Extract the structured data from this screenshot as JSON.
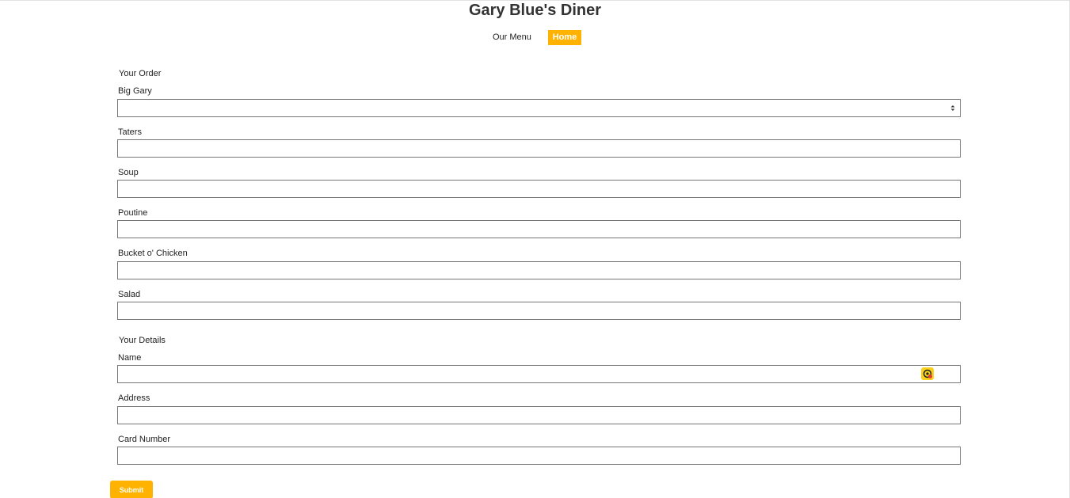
{
  "header": {
    "title": "Gary Blue's Diner"
  },
  "nav": {
    "items": [
      {
        "label": "Our Menu",
        "active": false
      },
      {
        "label": "Home",
        "active": true
      }
    ]
  },
  "order": {
    "legend": "Your Order",
    "fields": [
      {
        "label": "Big Gary",
        "value": "",
        "type": "select"
      },
      {
        "label": "Taters",
        "value": ""
      },
      {
        "label": "Soup",
        "value": ""
      },
      {
        "label": "Poutine",
        "value": ""
      },
      {
        "label": "Bucket o' Chicken",
        "value": ""
      },
      {
        "label": "Salad",
        "value": ""
      }
    ]
  },
  "details": {
    "legend": "Your Details",
    "fields": [
      {
        "label": "Name",
        "value": ""
      },
      {
        "label": "Address",
        "value": ""
      },
      {
        "label": "Card Number",
        "value": ""
      }
    ]
  },
  "form": {
    "submit_label": "Submit"
  },
  "icons": {
    "select_arrows": "updown-arrows-icon",
    "autofill": "password-manager-icon"
  },
  "colors": {
    "accent": "#ffb300",
    "accent_text": "#ffffff",
    "field_border": "#767676"
  }
}
